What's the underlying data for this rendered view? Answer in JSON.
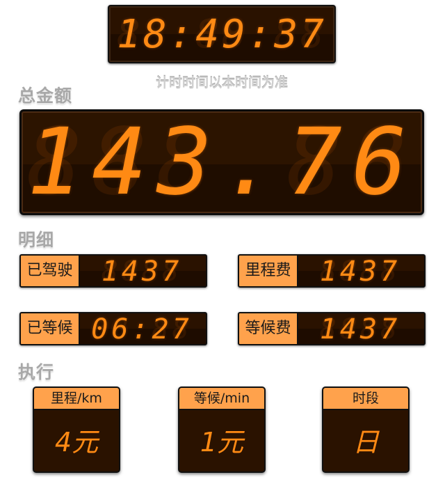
{
  "clock": {
    "ghost": "88:88:88",
    "time": "18:49:37",
    "note": "计时时间以本时间为准"
  },
  "total": {
    "title": "总金额",
    "ghost": "888.88",
    "value": "143.76"
  },
  "detail": {
    "title": "明细",
    "items": [
      {
        "label": "已驾驶",
        "ghost": "8888",
        "value": "1437"
      },
      {
        "label": "里程费",
        "ghost": "8888",
        "value": "1437"
      },
      {
        "label": "已等候",
        "ghost": "88:88",
        "value": "06:27"
      },
      {
        "label": "等候费",
        "ghost": "8888",
        "value": "1437"
      }
    ]
  },
  "execute": {
    "title": "执行",
    "cards": [
      {
        "label": "里程/km",
        "value": "4元"
      },
      {
        "label": "等候/min",
        "value": "1元"
      },
      {
        "label": "时段",
        "value": "日"
      }
    ]
  },
  "colors": {
    "digit": "#ff8a14",
    "label_bg": "#ffa24c",
    "panel_bg": "#2a1200"
  }
}
